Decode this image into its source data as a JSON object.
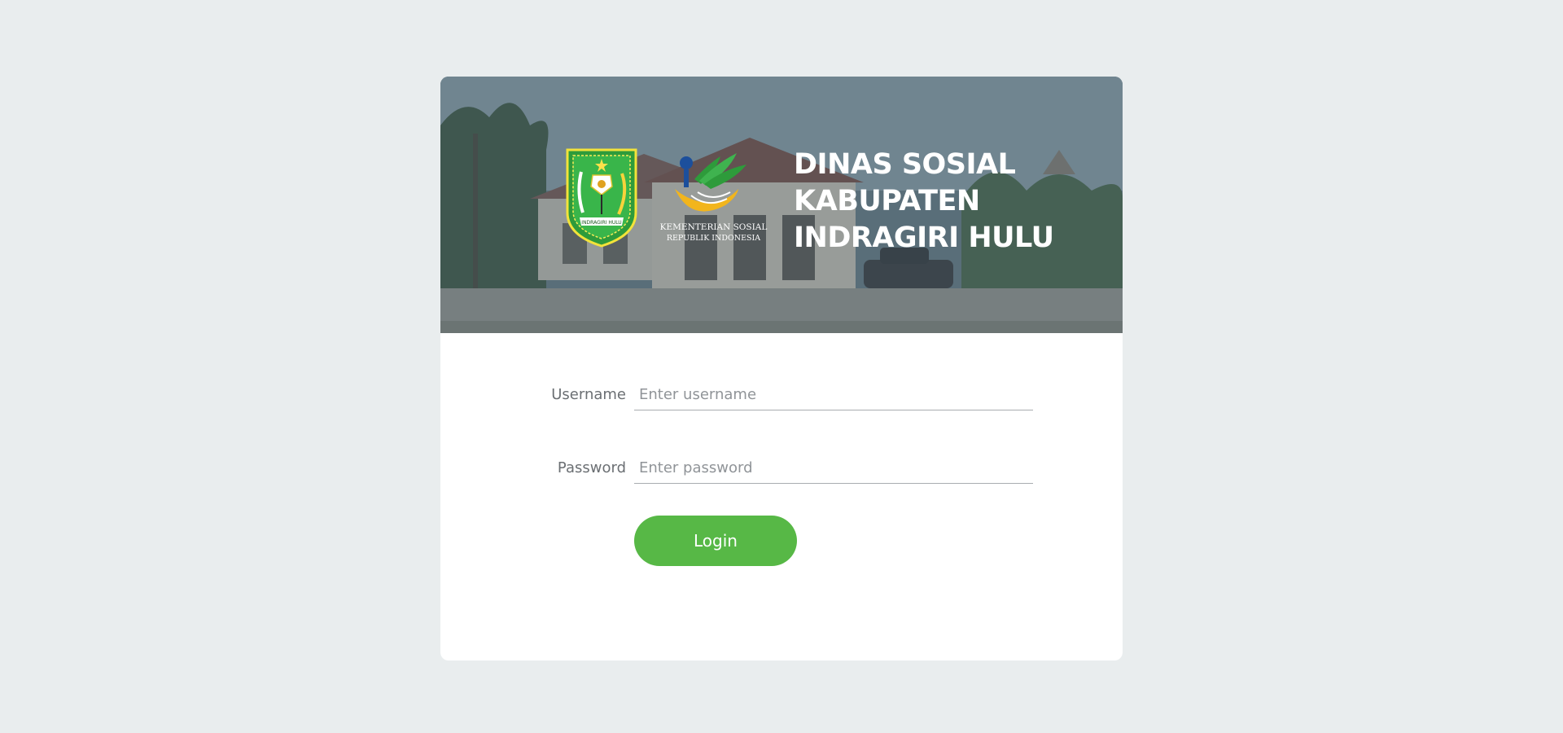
{
  "header": {
    "title_lines": [
      "DINAS SOSIAL",
      "KABUPATEN",
      "INDRAGIRI HULU"
    ],
    "regency_logo_icon": "regency-coat-of-arms-icon",
    "regency_motto": "INDRAGIRI HULU",
    "ministry_logo_icon": "kemensos-logo-icon",
    "ministry_text_line1": "KEMENTERIAN SOSIAL",
    "ministry_text_line2": "REPUBLIK INDONESIA"
  },
  "form": {
    "username_label": "Username",
    "username_placeholder": "Enter username",
    "username_value": "",
    "password_label": "Password",
    "password_placeholder": "Enter password",
    "password_value": "",
    "login_label": "Login"
  },
  "colors": {
    "page_background": "#e9edee",
    "card_background": "#ffffff",
    "accent_button": "#57b846",
    "banner_tint": "#3e5562"
  }
}
